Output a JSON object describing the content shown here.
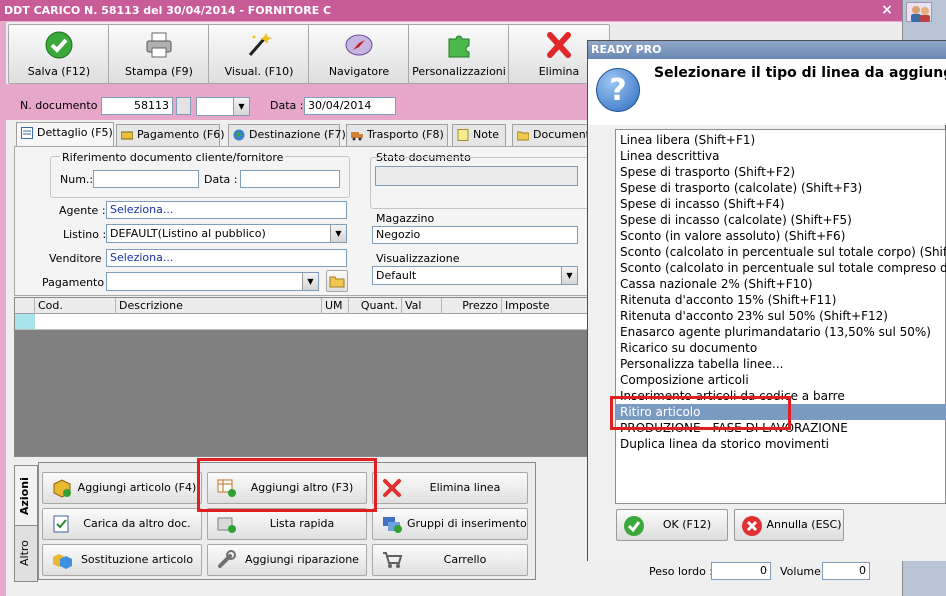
{
  "window": {
    "title": "DDT CARICO N. 58113 del 30/04/2014 - FORNITORE C",
    "close": "×"
  },
  "toolbar": [
    {
      "label": "Salva (F12)",
      "icon": "check-icon"
    },
    {
      "label": "Stampa (F9)",
      "icon": "printer-icon"
    },
    {
      "label": "Visual. (F10)",
      "icon": "magic-wand-icon"
    },
    {
      "label": "Navigatore",
      "icon": "compass-icon"
    },
    {
      "label": "Personalizzazioni",
      "icon": "puzzle-icon"
    },
    {
      "label": "Elimina",
      "icon": "delete-x-icon"
    }
  ],
  "header": {
    "doc_label": "N. documento :",
    "doc_number": "58113",
    "data_label": "Data :",
    "data_value": "30/04/2014"
  },
  "tabs": [
    {
      "label": "Dettaglio (F5)"
    },
    {
      "label": "Pagamento (F6)"
    },
    {
      "label": "Destinazione (F7)"
    },
    {
      "label": "Trasporto (F8)"
    },
    {
      "label": "Note"
    },
    {
      "label": "Documenti"
    }
  ],
  "dettaglio": {
    "rif_title": "Riferimento documento cliente/fornitore",
    "num_label": "Num.:",
    "num_value": "",
    "data_label": "Data :",
    "data_value": "",
    "agente_label": "Agente :",
    "agente_value": "Seleziona...",
    "listino_label": "Listino :",
    "listino_value": "DEFAULT(Listino al pubblico)",
    "venditore_label": "Venditore :",
    "venditore_value": "Seleziona...",
    "pagamento_label": "Pagamento :",
    "pagamento_value": "",
    "stato_title": "Stato documento",
    "magazzino_title": "Magazzino",
    "magazzino_value": "Negozio",
    "visualizzazione_title": "Visualizzazione",
    "visualizzazione_value": "Default"
  },
  "grid": {
    "columns": [
      "Cod.",
      "Descrizione",
      "UM",
      "Quant.",
      "Val",
      "Prezzo",
      "Imposte"
    ]
  },
  "side_tabs": [
    "Azioni",
    "Altro"
  ],
  "actions": [
    {
      "label": "Aggiungi articolo (F4)",
      "icon": "add-article-icon"
    },
    {
      "label": "Aggiungi altro (F3)",
      "icon": "add-other-icon"
    },
    {
      "label": "Elimina linea",
      "icon": "delete-line-icon"
    },
    {
      "label": "Carica da altro doc.",
      "icon": "load-doc-icon"
    },
    {
      "label": "Lista rapida",
      "icon": "quick-list-icon"
    },
    {
      "label": "Gruppi di inserimento",
      "icon": "insert-groups-icon"
    },
    {
      "label": "Sostituzione articolo",
      "icon": "replace-article-icon"
    },
    {
      "label": "Aggiungi riparazione",
      "icon": "repair-icon"
    },
    {
      "label": "Carrello",
      "icon": "cart-icon"
    }
  ],
  "footer": {
    "peso_label": "Peso lordo :",
    "peso_value": "0",
    "volume_label": "Volume :",
    "volume_value": "0"
  },
  "dialog": {
    "title": "READY PRO",
    "prompt": "Selezionare il tipo di linea da aggiunger",
    "items": [
      "Linea libera (Shift+F1)",
      "Linea descrittiva",
      "Spese di trasporto (Shift+F2)",
      "Spese di trasporto (calcolate) (Shift+F3)",
      "Spese di incasso (Shift+F4)",
      "Spese di incasso (calcolate) (Shift+F5)",
      "Sconto (in valore assoluto) (Shift+F6)",
      "Sconto (calcolato in percentuale sul totale corpo) (Shift+F",
      "Sconto (calcolato in percentuale sul totale compreso delle",
      "Cassa nazionale 2% (Shift+F10)",
      "Ritenuta d'acconto 15% (Shift+F11)",
      "Ritenuta d'acconto 23% sul 50% (Shift+F12)",
      "Enasarco agente plurimandatario (13,50% sul 50%)",
      "Ricarico su documento",
      "Personalizza tabella linee...",
      "Composizione articoli",
      "Inserimento articoli da codice a barre",
      "Ritiro articolo",
      "PRODUZIONE - FASE DI LAVORAZIONE",
      "Duplica linea da storico movimenti"
    ],
    "selected_index": 17,
    "ok_label": "OK (F12)",
    "cancel_label": "Annulla (ESC)"
  },
  "colors": {
    "title_bar": "#c85c98",
    "frame": "#e7a7cb",
    "selection": "#7b9ac2",
    "highlight_box": "#e02020"
  }
}
